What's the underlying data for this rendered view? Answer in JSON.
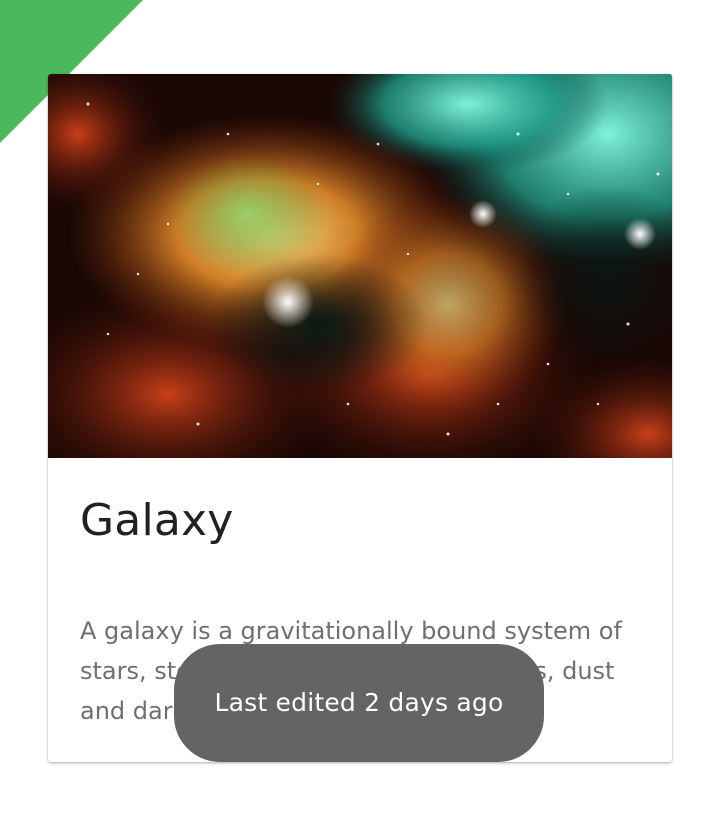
{
  "colors": {
    "ribbon": "#4cb85c",
    "toast_background": "#646464",
    "title_text": "#212121",
    "body_text": "#6f6f6f"
  },
  "card": {
    "image_icon": "nebula-image",
    "title": "Galaxy",
    "description": "A galaxy is a gravitationally bound system of stars, stellar remnants, interstellar gas, dust and dark matter."
  },
  "toast": {
    "message": "Last edited 2 days ago"
  }
}
